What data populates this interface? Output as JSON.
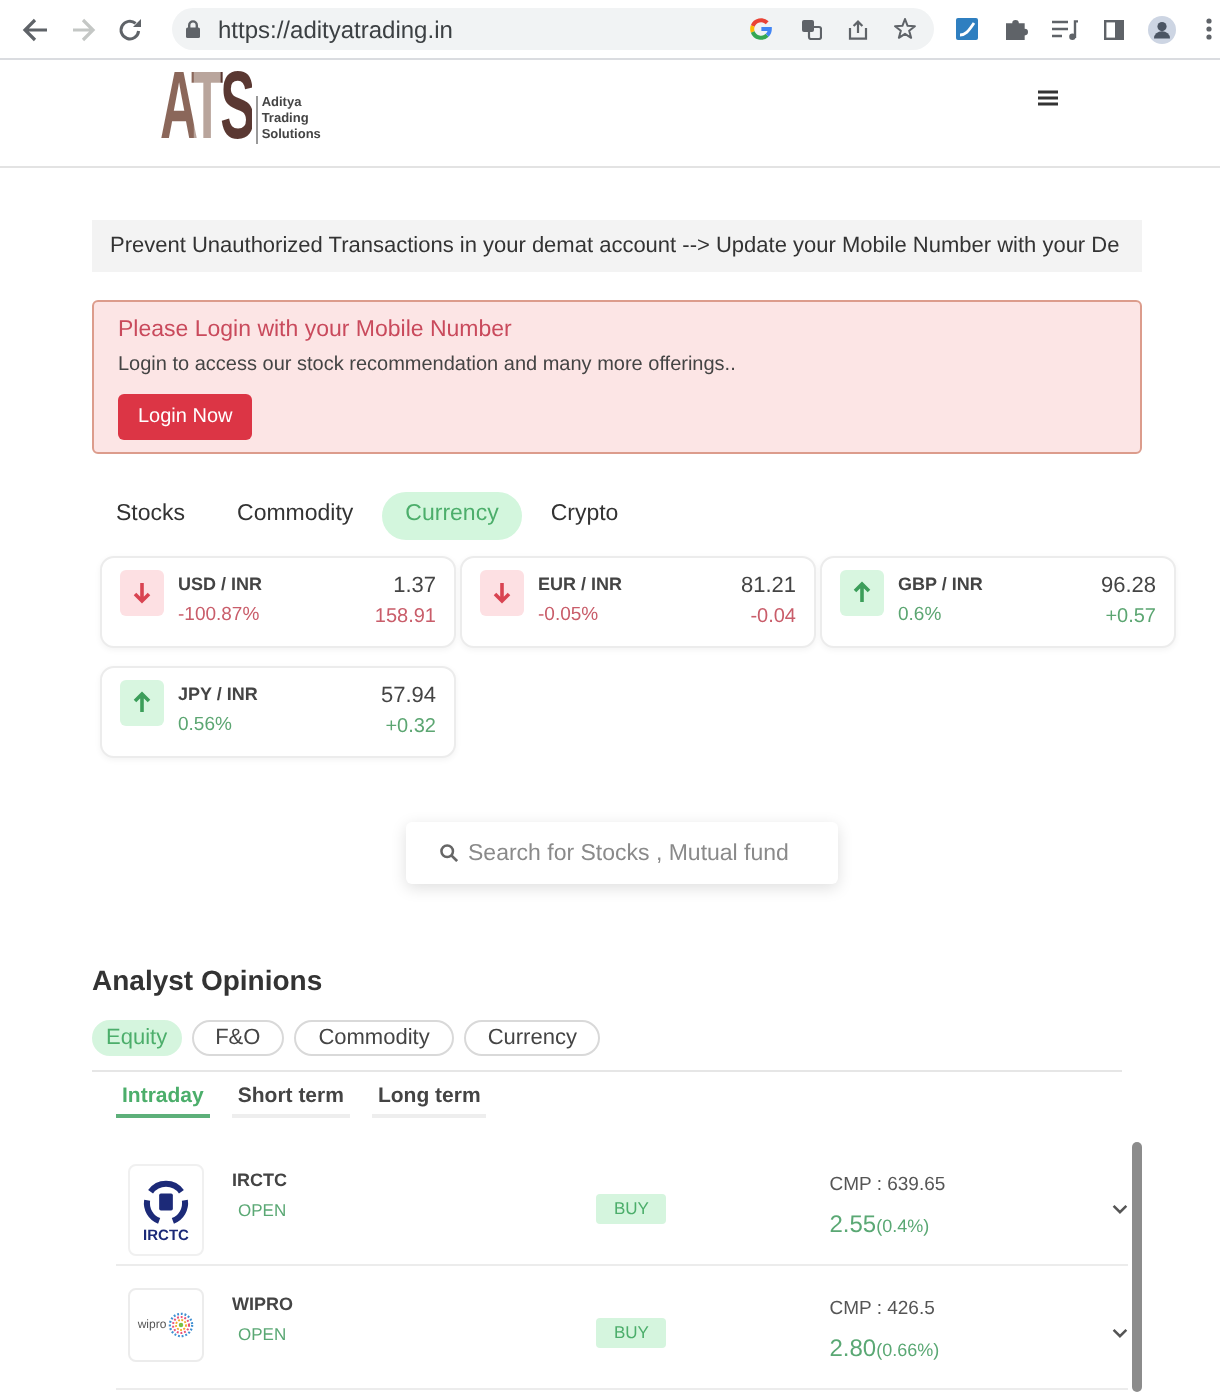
{
  "browser": {
    "url": "https://adityatrading.in",
    "forward_enabled": false
  },
  "header": {
    "logo_letters": "ATS",
    "logo_tagline": "Aditya Trading Solutions"
  },
  "notice": "Prevent Unauthorized Transactions in your demat account --> Update your Mobile Number with your De",
  "login_alert": {
    "title": "Please Login with your Mobile Number",
    "message": "Login to access our stock recommendation and many more offerings..",
    "button": "Login Now"
  },
  "market_tabs": [
    {
      "label": "Stocks",
      "selected": false
    },
    {
      "label": "Commodity",
      "selected": false
    },
    {
      "label": "Currency",
      "selected": true
    },
    {
      "label": "Crypto",
      "selected": false
    }
  ],
  "quotes": [
    {
      "kind": "down",
      "pair": "USD / INR",
      "price": "1.37",
      "change_pct": "-100.87%",
      "change": "158.91"
    },
    {
      "kind": "down",
      "pair": "EUR / INR",
      "price": "81.21",
      "change_pct": "-0.05%",
      "change": "-0.04"
    },
    {
      "kind": "up",
      "pair": "GBP / INR",
      "price": "96.28",
      "change_pct": "0.6%",
      "change": "+0.57"
    },
    {
      "kind": "up",
      "pair": "JPY / INR",
      "price": "57.94",
      "change_pct": "0.56%",
      "change": "+0.32"
    }
  ],
  "search": {
    "placeholder": "Search for Stocks , Mutual fund"
  },
  "analyst_opinions": {
    "title": "Analyst Opinions",
    "categories": [
      {
        "label": "Equity",
        "selected": true
      },
      {
        "label": "F&O",
        "selected": false
      },
      {
        "label": "Commodity",
        "selected": false
      },
      {
        "label": "Currency",
        "selected": false
      }
    ],
    "horizons": [
      {
        "label": "Intraday",
        "selected": true
      },
      {
        "label": "Short term",
        "selected": false
      },
      {
        "label": "Long term",
        "selected": false
      }
    ],
    "recommendations": [
      {
        "logo": {
          "kind": "emblem",
          "text": "IRCTC"
        },
        "name": "IRCTC",
        "status": "OPEN",
        "action": "BUY",
        "cmp": "CMP : 639.65",
        "change": "2.55",
        "change_pct": "(0.4%)",
        "expanded": false
      },
      {
        "logo": {
          "kind": "rings",
          "text": "wipro"
        },
        "name": "WIPRO",
        "status": "OPEN",
        "action": "BUY",
        "cmp": "CMP : 426.5",
        "change": "2.80",
        "change_pct": "(0.66%)",
        "expanded": false
      }
    ]
  }
}
